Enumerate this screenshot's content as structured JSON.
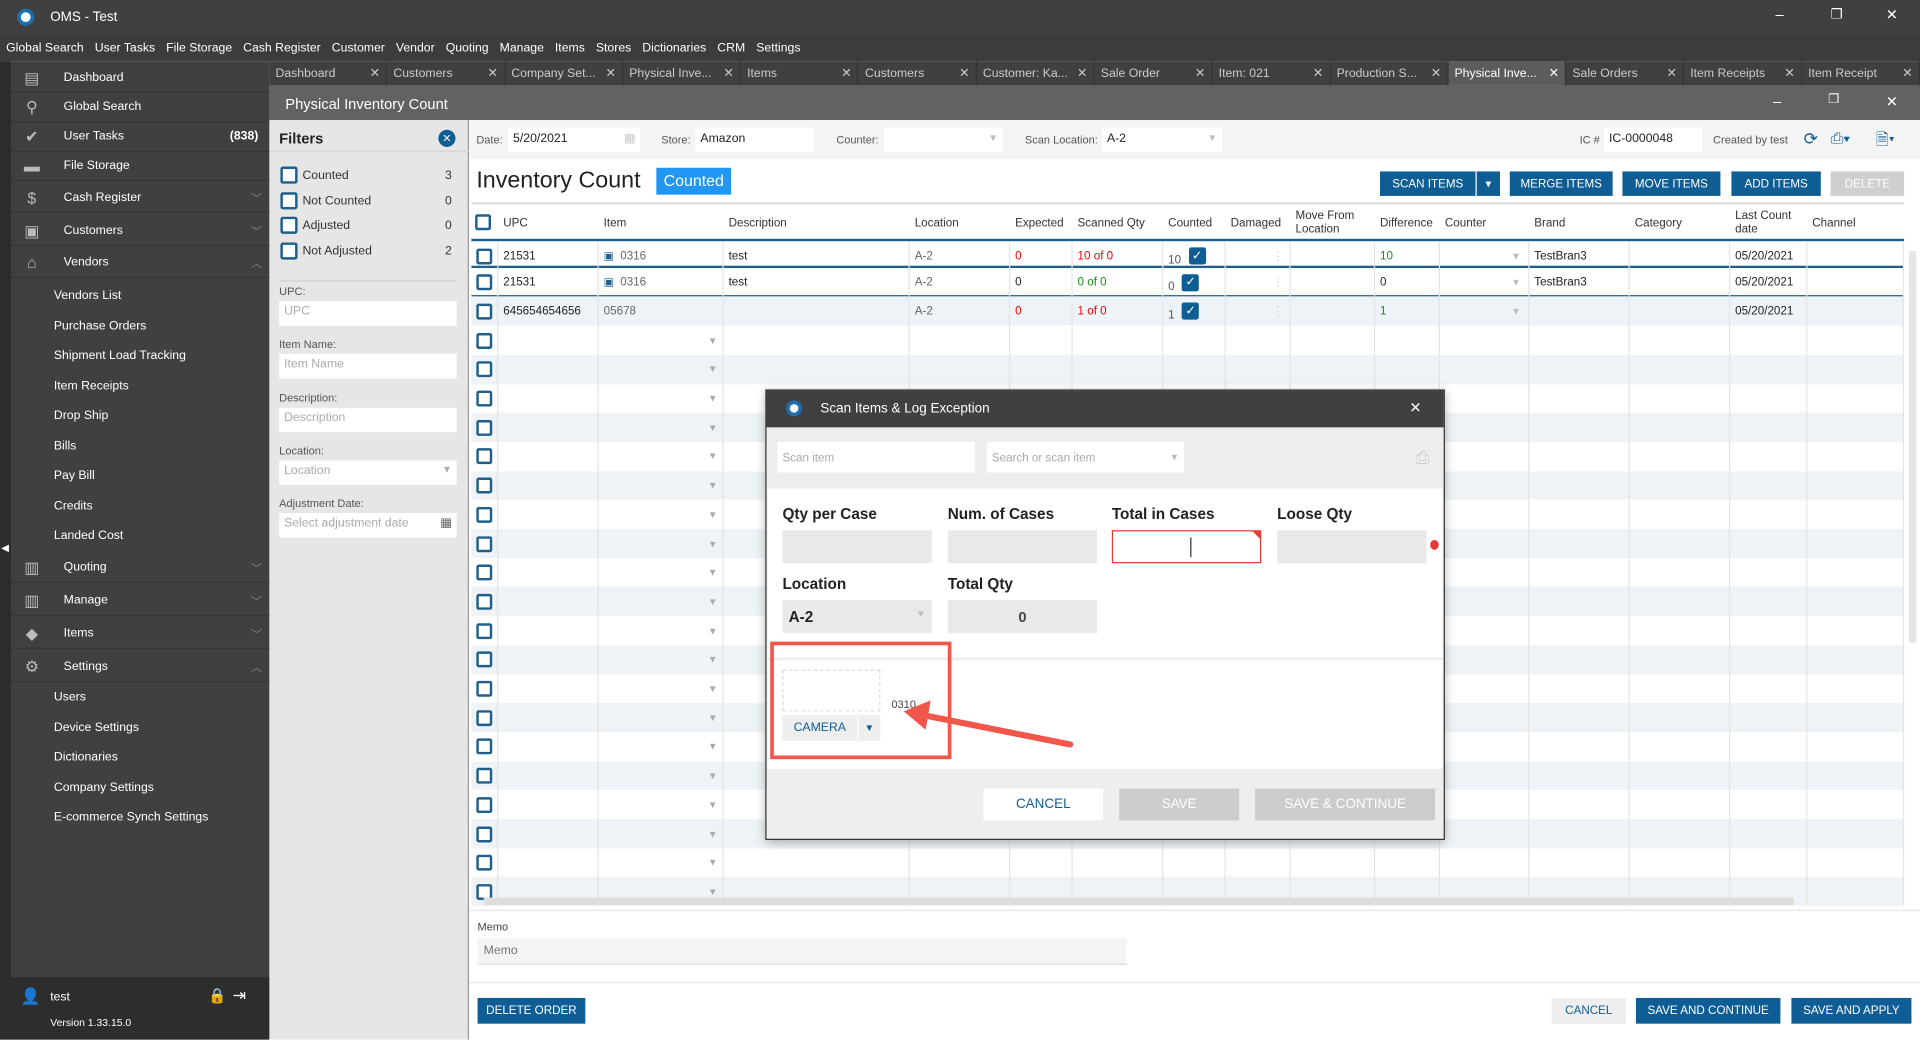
{
  "app": {
    "title": "OMS - Test"
  },
  "menu": [
    "Global Search",
    "User Tasks",
    "File Storage",
    "Cash Register",
    "Customer",
    "Vendor",
    "Quoting",
    "Manage",
    "Items",
    "Stores",
    "Dictionaries",
    "CRM",
    "Settings"
  ],
  "sidebar": {
    "items": [
      {
        "label": "Dashboard",
        "icon": "dashboard-icon"
      },
      {
        "label": "Global Search",
        "icon": "search-icon"
      },
      {
        "label": "User Tasks",
        "icon": "check-circle-icon",
        "badge": "(838)"
      },
      {
        "label": "File Storage",
        "icon": "folder-icon"
      },
      {
        "label": "Cash Register",
        "icon": "dollar-icon"
      },
      {
        "label": "Customers",
        "icon": "person-icon"
      },
      {
        "label": "Vendors",
        "icon": "store-icon"
      }
    ],
    "vendor_sub": [
      "Vendors List",
      "Purchase Orders",
      "Shipment Load Tracking",
      "Item Receipts",
      "Drop Ship",
      "Bills",
      "Pay Bill",
      "Credits",
      "Landed Cost"
    ],
    "items2": [
      {
        "label": "Quoting",
        "icon": "clipboard-icon"
      },
      {
        "label": "Manage",
        "icon": "clipboard-icon"
      },
      {
        "label": "Items",
        "icon": "tag-icon"
      },
      {
        "label": "Settings",
        "icon": "gear-icon"
      }
    ],
    "settings_sub": [
      "Users",
      "Device Settings",
      "Dictionaries",
      "Company Settings",
      "E-commerce Synch Settings"
    ],
    "user": "test",
    "version": "Version 1.33.15.0"
  },
  "tabs": [
    "Dashboard",
    "Customers",
    "Company Set...",
    "Physical Inve...",
    "Items",
    "Customers",
    "Customer: Ka...",
    "Sale Order",
    "Item: 021",
    "Production S...",
    "Physical Inve...",
    "Sale Orders",
    "Item Receipts",
    "Item Receipt"
  ],
  "window": {
    "title": "Physical Inventory Count"
  },
  "filters": {
    "title": "Filters",
    "checks": [
      {
        "label": "Counted",
        "count": "3"
      },
      {
        "label": "Not Counted",
        "count": "0"
      },
      {
        "label": "Adjusted",
        "count": "0"
      },
      {
        "label": "Not Adjusted",
        "count": "2"
      }
    ],
    "fields": [
      {
        "label": "UPC:",
        "placeholder": "UPC"
      },
      {
        "label": "Item Name:",
        "placeholder": "Item Name"
      },
      {
        "label": "Description:",
        "placeholder": "Description"
      },
      {
        "label": "Location:",
        "placeholder": "Location"
      },
      {
        "label": "Adjustment Date:",
        "placeholder": "Select adjustment date"
      }
    ]
  },
  "toolbar": {
    "date_label": "Date:",
    "date": "5/20/2021",
    "store_label": "Store:",
    "store": "Amazon",
    "counter_label": "Counter:",
    "counter": "",
    "scan_loc_label": "Scan Location:",
    "scan_loc": "A-2",
    "ic_label": "IC #",
    "ic": "IC-0000048",
    "created_by": "Created by test"
  },
  "heading": {
    "title": "Inventory Count",
    "status": "Counted"
  },
  "actions": {
    "scan": "SCAN ITEMS",
    "merge": "MERGE ITEMS",
    "move": "MOVE ITEMS",
    "add": "ADD ITEMS",
    "delete": "DELETE"
  },
  "columns": [
    "UPC",
    "Item",
    "Description",
    "Location",
    "Expected",
    "Scanned Qty",
    "Counted",
    "Damaged",
    "Move From Location",
    "Difference",
    "Counter",
    "Brand",
    "Category",
    "Last Count date",
    "Channel"
  ],
  "rows": [
    {
      "upc": "21531",
      "item": "0316",
      "desc": "test",
      "loc": "A-2",
      "expected": "0",
      "scanned": "10 of 0",
      "counted": "10",
      "diff": "10",
      "brand": "TestBran3",
      "date": "05/20/2021",
      "exp_red": true,
      "sc_color": "red"
    },
    {
      "upc": "21531",
      "item": "0316",
      "desc": "test",
      "loc": "A-2",
      "expected": "0",
      "scanned": "0 of 0",
      "counted": "0",
      "diff": "0",
      "brand": "TestBran3",
      "date": "05/20/2021",
      "exp_red": false,
      "sc_color": "green"
    },
    {
      "upc": "645654654656",
      "item": "05678",
      "desc": "",
      "loc": "A-2",
      "expected": "0",
      "scanned": "1 of 0",
      "counted": "1",
      "diff": "1",
      "brand": "",
      "date": "05/20/2021",
      "exp_red": true,
      "sc_color": "red"
    }
  ],
  "memo": {
    "label": "Memo",
    "placeholder": "Memo"
  },
  "footer": {
    "delete": "DELETE ORDER",
    "cancel": "CANCEL",
    "save_continue": "SAVE AND CONTINUE",
    "save_apply": "SAVE AND APPLY"
  },
  "modal": {
    "title": "Scan Items & Log Exception",
    "scan_placeholder": "Scan item",
    "search_placeholder": "Search or scan item",
    "qty_per_case": "Qty per Case",
    "num_cases": "Num. of Cases",
    "total_cases": "Total in Cases",
    "loose_qty": "Loose Qty",
    "location": "Location",
    "location_value": "A-2",
    "total_qty": "Total Qty",
    "total_qty_value": "0",
    "image_code": "0310",
    "camera": "CAMERA",
    "cancel": "CANCEL",
    "save": "SAVE",
    "save_continue": "SAVE & CONTINUE"
  },
  "colors": {
    "accent": "#0e5d94",
    "badge": "#2196f3",
    "error": "#e53935",
    "annotation": "#f0564a"
  }
}
